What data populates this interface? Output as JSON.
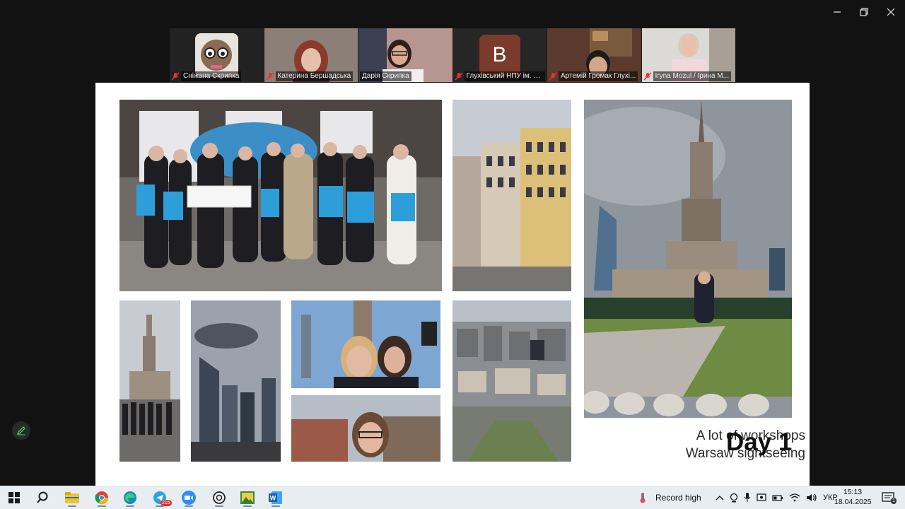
{
  "window": {
    "controls": {
      "minimize": "minimize",
      "maximize": "maximize",
      "close": "close"
    }
  },
  "participants": [
    {
      "name": "Сніжана Скрипка",
      "muted": true,
      "active": false
    },
    {
      "name": "Катерина Бершадська",
      "muted": true,
      "active": false
    },
    {
      "name": "Дарія Скрипка",
      "muted": false,
      "active": true
    },
    {
      "name": "Глухівський НПУ ім. Д...",
      "muted": true,
      "active": false,
      "avatar_letter": "В"
    },
    {
      "name": "Артемій Громак Глухі...",
      "muted": true,
      "active": false
    },
    {
      "name": "Iryna Mozul / Ірина М...",
      "muted": true,
      "active": false
    }
  ],
  "slide": {
    "caption_line1": "A lot of workshops",
    "caption_line2": "Warsaw sightseeing",
    "day_title": "Day 1"
  },
  "taskbar": {
    "record_label": "Record high",
    "language": "УКР",
    "time": "15:13",
    "date": "18.04.2025",
    "telegram_badge": "215",
    "notification_count": "1",
    "apps": [
      "windows-start",
      "search",
      "file-explorer",
      "chrome",
      "edge",
      "telegram",
      "zoom",
      "chatgpt",
      "image-viewer",
      "word"
    ]
  },
  "colors": {
    "active_speaker_border": "#2ed36a",
    "avatar_bg": "#7a3a2c",
    "taskbar_bg": "#e8edf2",
    "slide_bg": "#ffffff"
  }
}
